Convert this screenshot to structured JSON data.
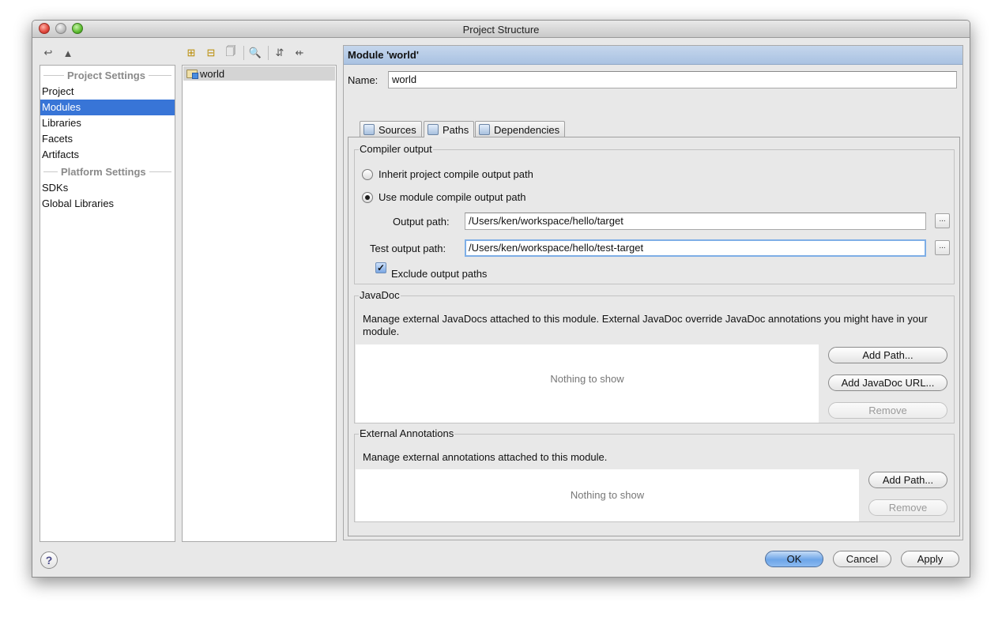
{
  "window": {
    "title": "Project Structure"
  },
  "sidebar": {
    "project_settings_header": "Project Settings",
    "platform_settings_header": "Platform Settings",
    "items": [
      {
        "label": "Project"
      },
      {
        "label": "Modules"
      },
      {
        "label": "Libraries"
      },
      {
        "label": "Facets"
      },
      {
        "label": "Artifacts"
      }
    ],
    "platform_items": [
      {
        "label": "SDKs"
      },
      {
        "label": "Global Libraries"
      }
    ]
  },
  "module_tree": {
    "items": [
      {
        "label": "world"
      }
    ]
  },
  "detail": {
    "header": "Module 'world'",
    "name_label": "Name:",
    "name_value": "world",
    "tabs": [
      {
        "label": "Sources"
      },
      {
        "label": "Paths"
      },
      {
        "label": "Dependencies"
      }
    ],
    "compiler_output": {
      "title": "Compiler output",
      "inherit_label": "Inherit project compile output path",
      "use_module_label": "Use module compile output path",
      "output_path_label": "Output path:",
      "output_path_value": "/Users/ken/workspace/hello/target",
      "test_output_path_label": "Test output path:",
      "test_output_path_value": "/Users/ken/workspace/hello/test-target",
      "browse_label": "...",
      "exclude_label": "Exclude output paths",
      "exclude_checked": true,
      "selected_option": "use_module"
    },
    "javadoc": {
      "title": "JavaDoc",
      "description": "Manage external JavaDocs attached to this module. External JavaDoc override JavaDoc annotations you might have in your module.",
      "empty_text": "Nothing to show",
      "add_path_label": "Add Path...",
      "add_url_label": "Add JavaDoc URL...",
      "remove_label": "Remove"
    },
    "annotations": {
      "title": "External Annotations",
      "description": "Manage external annotations attached to this module.",
      "empty_text": "Nothing to show",
      "add_path_label": "Add Path...",
      "remove_label": "Remove"
    }
  },
  "footer": {
    "help_label": "?",
    "ok_label": "OK",
    "cancel_label": "Cancel",
    "apply_label": "Apply"
  },
  "colors": {
    "selection": "#3875d7",
    "header_blue": "#a9c2e2",
    "window_bg": "#e8e8e8"
  }
}
